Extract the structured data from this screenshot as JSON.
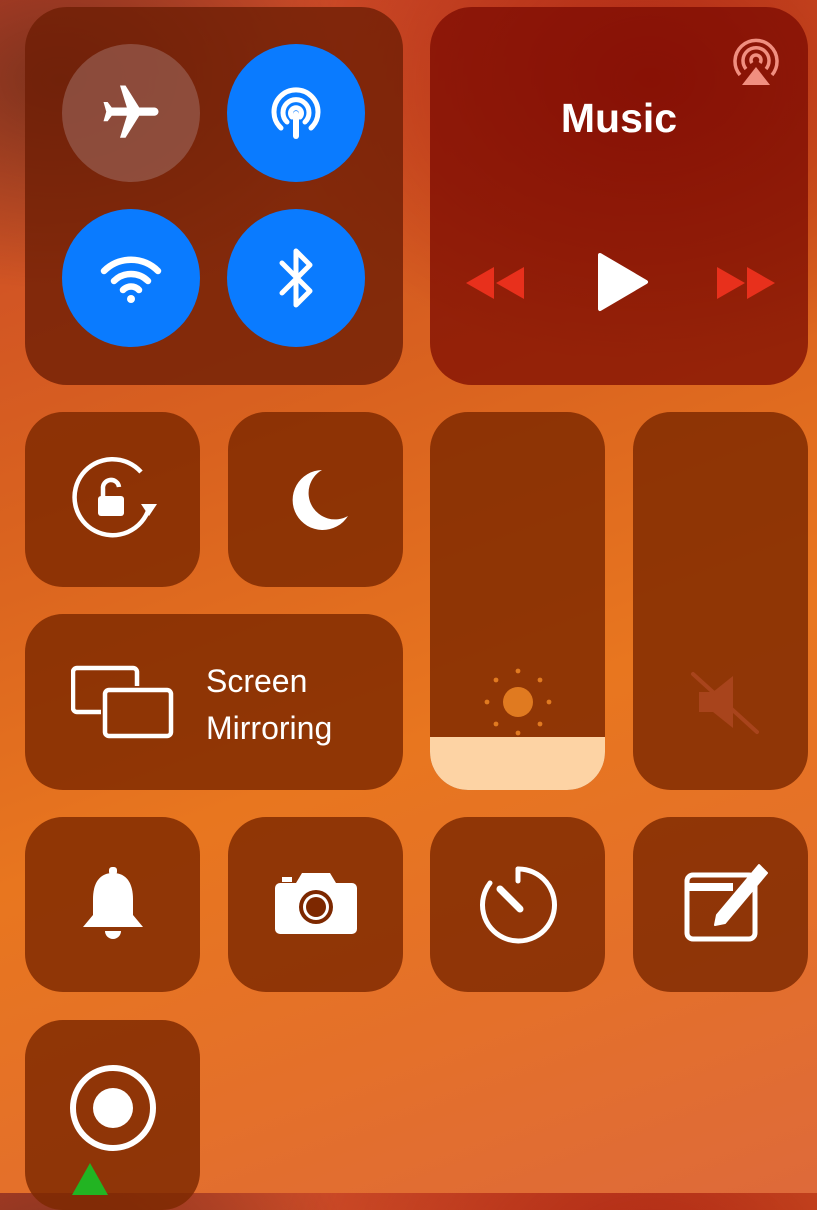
{
  "connectivity": {
    "airplane_mode": {
      "icon": "airplane-icon",
      "state": "off"
    },
    "airdrop": {
      "icon": "airdrop-icon",
      "state": "on"
    },
    "wifi": {
      "icon": "wifi-icon",
      "state": "on"
    },
    "bluetooth": {
      "icon": "bluetooth-icon",
      "state": "on"
    }
  },
  "music": {
    "title": "Music",
    "airplay_icon": "airplay-audio-icon",
    "controls": [
      "rewind-icon",
      "play-icon",
      "fast-forward-icon"
    ],
    "skip_color": "#e8301c"
  },
  "toggles": {
    "orientation_lock": {
      "icon": "orientation-lock-icon"
    },
    "do_not_disturb": {
      "icon": "moon-icon"
    }
  },
  "screen_mirroring": {
    "line1": "Screen",
    "line2": "Mirroring",
    "icon": "screen-mirroring-icon"
  },
  "brightness": {
    "icon": "sun-icon",
    "level": 0.14,
    "fill_color": "#fdd3a4"
  },
  "volume": {
    "icon": "speaker-muted-icon",
    "level": 0.0
  },
  "shortcuts": [
    "bell-icon",
    "camera-icon",
    "timer-icon",
    "notes-icon"
  ],
  "screen_recording": {
    "icon": "record-icon"
  },
  "colors": {
    "accent": "#0a7bff",
    "tile": "#7d2800"
  }
}
